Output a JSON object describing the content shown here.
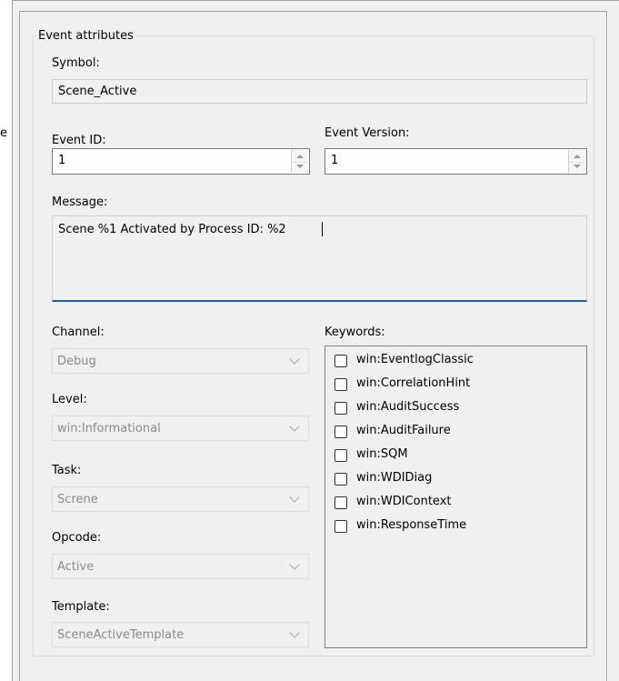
{
  "left_pane": {
    "partial_text": "e"
  },
  "group": {
    "title": "Event attributes",
    "symbol": {
      "label": "Symbol:",
      "value": "Scene_Active"
    },
    "event_id": {
      "label": "Event ID:",
      "value": "1"
    },
    "event_version": {
      "label": "Event Version:",
      "value": "1"
    },
    "message": {
      "label": "Message:",
      "value": "Scene %1 Activated by Process ID: %2"
    },
    "channel": {
      "label": "Channel:",
      "value": "Debug"
    },
    "level": {
      "label": "Level:",
      "value": "win:Informational"
    },
    "task": {
      "label": "Task:",
      "value": "Screne"
    },
    "opcode": {
      "label": "Opcode:",
      "value": "Active"
    },
    "template": {
      "label": "Template:",
      "value": "SceneActiveTemplate"
    },
    "keywords": {
      "label": "Keywords:",
      "items": [
        {
          "label": "win:EventlogClassic",
          "checked": false
        },
        {
          "label": "win:CorrelationHint",
          "checked": false
        },
        {
          "label": "win:AuditSuccess",
          "checked": false
        },
        {
          "label": "win:AuditFailure",
          "checked": false
        },
        {
          "label": "win:SQM",
          "checked": false
        },
        {
          "label": "win:WDIDiag",
          "checked": false
        },
        {
          "label": "win:WDIContext",
          "checked": false
        },
        {
          "label": "win:ResponseTime",
          "checked": false
        }
      ]
    }
  },
  "colors": {
    "focus_accent": "#0067c0",
    "disabled_text": "#8a8a8a"
  }
}
